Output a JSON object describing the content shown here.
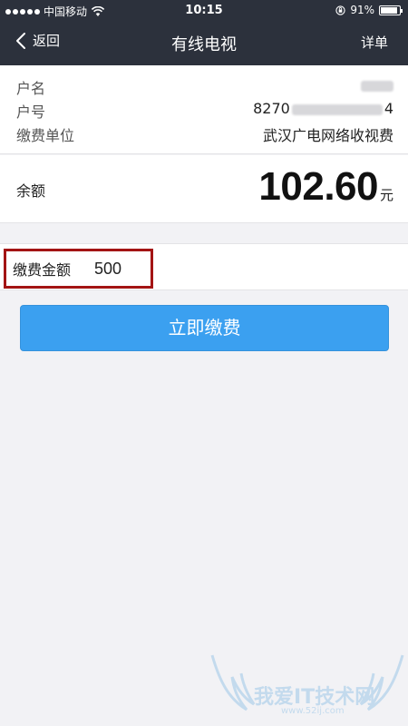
{
  "status_bar": {
    "carrier": "中国移动",
    "time": "10:15",
    "battery": "91%",
    "battery_level": 0.91,
    "icons": [
      "signal-dots-icon",
      "wifi-icon",
      "orientation-lock-icon",
      "battery-icon"
    ]
  },
  "nav": {
    "back_label": "返回",
    "title": "有线电视",
    "detail_label": "详单"
  },
  "account": {
    "name_label": "户名",
    "name_value": "",
    "number_label": "户号",
    "number_prefix": "8270",
    "number_suffix": "4",
    "unit_label": "缴费单位",
    "unit_value": "武汉广电网络收视费"
  },
  "balance": {
    "label": "余额",
    "amount": "102.60",
    "unit": "元"
  },
  "payment": {
    "label": "缴费金额",
    "amount_value": "500",
    "highlight_color": "#a31414"
  },
  "pay_button": {
    "label": "立即缴费",
    "color": "#3ba0f0"
  },
  "watermark": {
    "text": "我爱IT技术网",
    "url": "www.52ij.com"
  }
}
